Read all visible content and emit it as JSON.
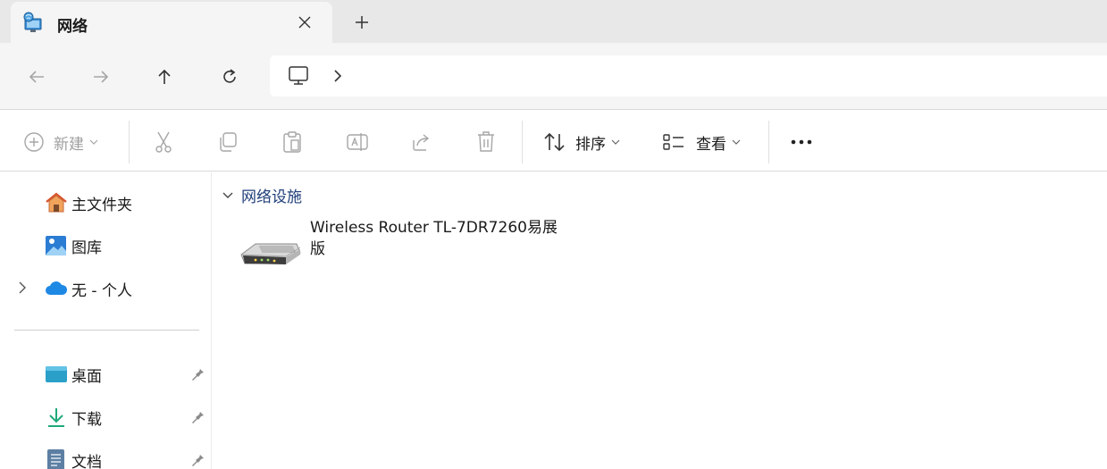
{
  "tab": {
    "title": "网络",
    "icon": "network-icon"
  },
  "toolbar": {
    "new_label": "新建",
    "sort_label": "排序",
    "view_label": "查看"
  },
  "sidebar": {
    "items": [
      {
        "label": "主文件夹",
        "icon": "home-icon"
      },
      {
        "label": "图库",
        "icon": "gallery-icon"
      },
      {
        "label": "无 - 个人",
        "icon": "onedrive-icon"
      },
      {
        "label": "桌面",
        "icon": "desktop-icon"
      },
      {
        "label": "下载",
        "icon": "download-icon"
      },
      {
        "label": "文档",
        "icon": "document-icon"
      }
    ]
  },
  "content": {
    "group_label": "网络设施",
    "devices": [
      {
        "name": "Wireless Router TL-7DR7260易展版",
        "icon": "router-icon"
      }
    ]
  },
  "colors": {
    "accent": "#1f3e7a",
    "tabstrip": "#e8e8e8",
    "navbar": "#f5f5f5",
    "folder_blue": "#2b7cd3"
  }
}
